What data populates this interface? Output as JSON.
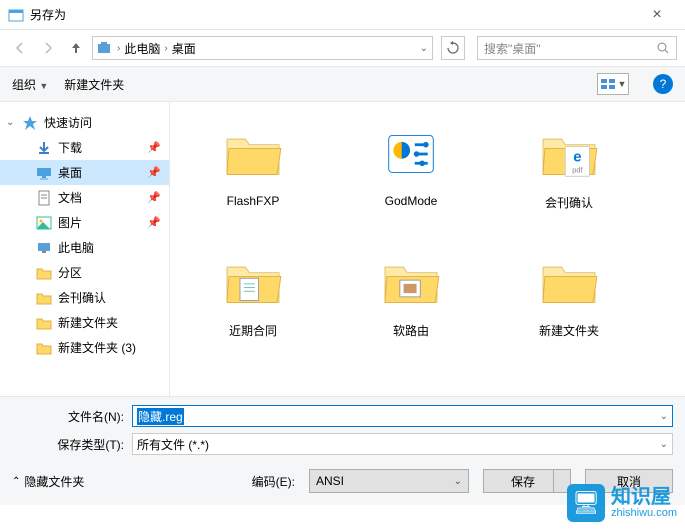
{
  "window": {
    "title": "另存为"
  },
  "nav": {
    "path": [
      "此电脑",
      "桌面"
    ],
    "search_placeholder": "搜索\"桌面\""
  },
  "toolbar": {
    "organize": "组织",
    "new_folder": "新建文件夹"
  },
  "tree": {
    "quick_access": "快速访问",
    "items": [
      {
        "label": "下载",
        "pinned": true,
        "type": "down"
      },
      {
        "label": "桌面",
        "pinned": true,
        "selected": true,
        "type": "desktop"
      },
      {
        "label": "文档",
        "pinned": true,
        "type": "doc"
      },
      {
        "label": "图片",
        "pinned": true,
        "type": "pic"
      },
      {
        "label": "此电脑",
        "type": "pc"
      },
      {
        "label": "分区",
        "type": "folder"
      },
      {
        "label": "会刊确认",
        "type": "folder"
      },
      {
        "label": "新建文件夹",
        "type": "folder"
      },
      {
        "label": "新建文件夹 (3)",
        "type": "folder"
      }
    ]
  },
  "files": [
    {
      "label": "FlashFXP",
      "type": "folder"
    },
    {
      "label": "GodMode",
      "type": "godmode"
    },
    {
      "label": "会刊确认",
      "type": "folder-edge"
    },
    {
      "label": "近期合同",
      "type": "folder-doc"
    },
    {
      "label": "软路由",
      "type": "folder-img"
    },
    {
      "label": "新建文件夹",
      "type": "folder"
    }
  ],
  "bottom": {
    "filename_label": "文件名(N):",
    "filename_value": "隐藏.reg",
    "filetype_label": "保存类型(T):",
    "filetype_value": "所有文件 (*.*)",
    "hide_folders": "隐藏文件夹",
    "encoding_label": "编码(E):",
    "encoding_value": "ANSI",
    "save": "保存",
    "cancel": "取消"
  },
  "watermark": {
    "name": "知识屋",
    "url": "zhishiwu.com"
  }
}
